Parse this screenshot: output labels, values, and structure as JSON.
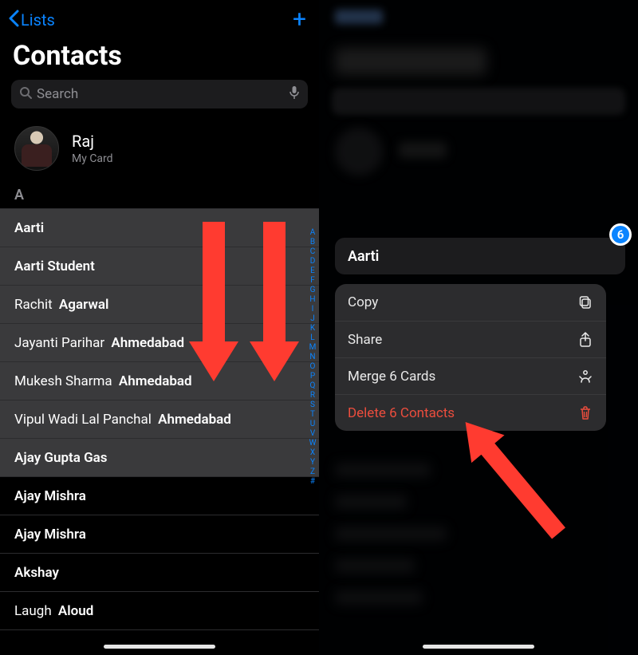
{
  "left": {
    "back_label": "Lists",
    "title": "Contacts",
    "search_placeholder": "Search",
    "my_card": {
      "name": "Raj",
      "subtitle": "My Card"
    },
    "section": "A",
    "contacts": [
      {
        "first": "",
        "last": "Aarti",
        "selected": true
      },
      {
        "first": "",
        "last": "Aarti Student",
        "selected": true
      },
      {
        "first": "Rachit",
        "last": "Agarwal",
        "selected": true
      },
      {
        "first": "Jayanti Parihar",
        "last": "Ahmedabad",
        "selected": true
      },
      {
        "first": "Mukesh Sharma",
        "last": "Ahmedabad",
        "selected": true
      },
      {
        "first": "Vipul Wadi Lal Panchal",
        "last": "Ahmedabad",
        "selected": true
      },
      {
        "first": "",
        "last": "Ajay Gupta Gas",
        "selected": true
      },
      {
        "first": "",
        "last": "Ajay Mishra",
        "selected": false
      },
      {
        "first": "",
        "last": "Ajay Mishra",
        "selected": false
      },
      {
        "first": "",
        "last": "Akshay",
        "selected": false
      },
      {
        "first": "Laugh",
        "last": "Aloud",
        "selected": false
      }
    ],
    "alpha": [
      "A",
      "B",
      "C",
      "D",
      "E",
      "F",
      "G",
      "H",
      "I",
      "J",
      "K",
      "L",
      "M",
      "N",
      "O",
      "P",
      "Q",
      "R",
      "S",
      "T",
      "U",
      "V",
      "W",
      "X",
      "Y",
      "Z",
      "#"
    ]
  },
  "right": {
    "badge_count": "6",
    "selected_name": "Aarti",
    "menu": {
      "copy": "Copy",
      "share": "Share",
      "merge": "Merge 6 Cards",
      "delete": "Delete 6 Contacts"
    }
  }
}
